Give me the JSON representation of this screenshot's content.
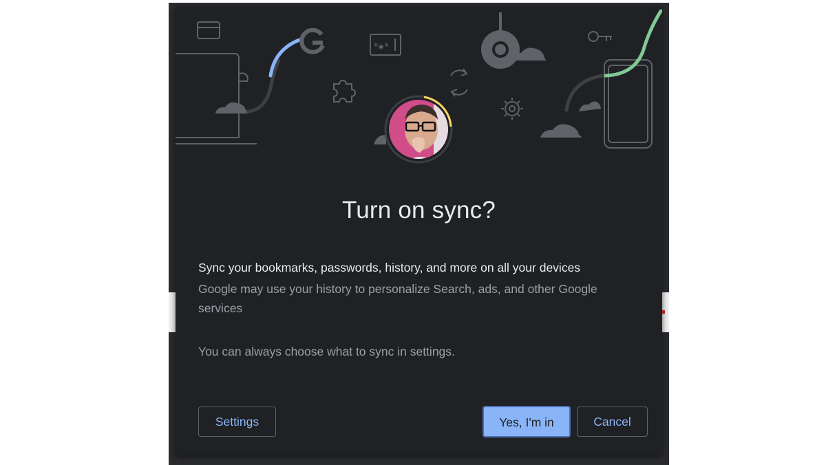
{
  "dialog": {
    "title": "Turn on sync?",
    "sync_heading": "Sync your bookmarks, passwords, history, and more on all your devices",
    "sync_description": "Google may use your history to personalize Search, ads, and other Google services",
    "settings_note": "You can always choose what to sync in settings."
  },
  "buttons": {
    "settings_label": "Settings",
    "confirm_label": "Yes, I'm in",
    "cancel_label": "Cancel"
  },
  "illustration": {
    "icons": [
      "card-icon",
      "laptop-icon",
      "cloud-icon",
      "google-g-icon",
      "password-field-icon",
      "puzzle-icon",
      "sync-icon",
      "chrome-icon",
      "gear-icon",
      "key-icon",
      "phone-icon"
    ],
    "accent_colors": {
      "blue": "#8ab4f8",
      "green": "#81c995",
      "yellow": "#fdd663"
    }
  },
  "theme": {
    "dialog_bg": "#202124",
    "primary_text": "#e8eaed",
    "secondary_text": "#9aa0a6",
    "accent": "#8ab4f8"
  }
}
